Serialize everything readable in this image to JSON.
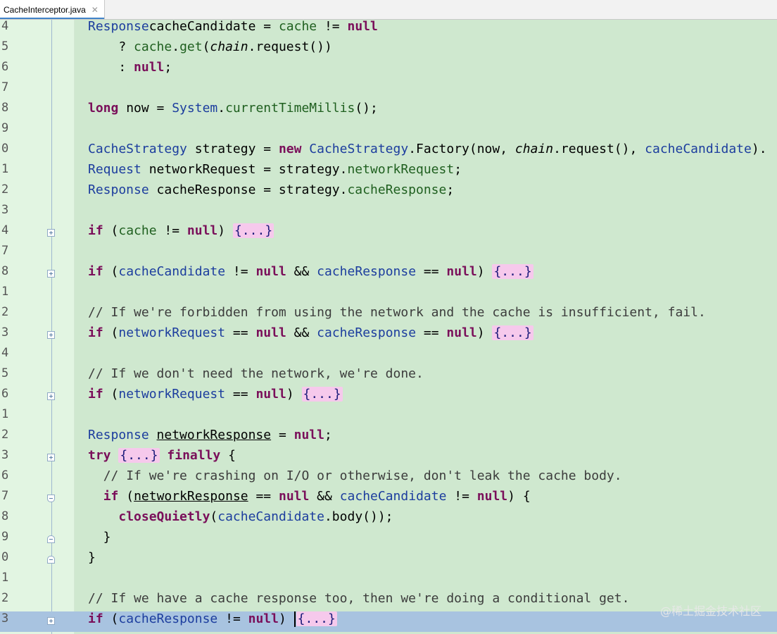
{
  "tab": {
    "title": "CacheInterceptor.java",
    "close": "✕"
  },
  "lines": [
    {
      "num": "4",
      "fold": "",
      "code": [
        [
          "ty",
          "Response"
        ],
        [
          "",
          "cacheCandidate = "
        ],
        [
          "mt",
          "cache"
        ],
        [
          "",
          " != "
        ],
        [
          "kw",
          "null"
        ]
      ]
    },
    {
      "num": "5",
      "fold": "",
      "code": [
        [
          "",
          "    ? "
        ],
        [
          "mt",
          "cache"
        ],
        [
          "",
          "."
        ],
        [
          "mt",
          "get"
        ],
        [
          "",
          "("
        ],
        [
          "it",
          "chain"
        ],
        [
          "",
          ".request())"
        ]
      ]
    },
    {
      "num": "6",
      "fold": "",
      "code": [
        [
          "",
          "    : "
        ],
        [
          "kw",
          "null"
        ],
        [
          "",
          ";"
        ]
      ]
    },
    {
      "num": "7",
      "fold": "",
      "code": []
    },
    {
      "num": "8",
      "fold": "",
      "code": [
        [
          "kw",
          "long"
        ],
        [
          "",
          " now = "
        ],
        [
          "ty",
          "System"
        ],
        [
          "",
          "."
        ],
        [
          "mt",
          "currentTimeMillis"
        ],
        [
          "",
          "();"
        ]
      ]
    },
    {
      "num": "9",
      "fold": "",
      "code": []
    },
    {
      "num": "0",
      "fold": "",
      "code": [
        [
          "ty",
          "CacheStrategy"
        ],
        [
          "",
          " strategy = "
        ],
        [
          "kw",
          "new"
        ],
        [
          "",
          " "
        ],
        [
          "ty",
          "CacheStrategy"
        ],
        [
          "",
          ".Factory(now, "
        ],
        [
          "it",
          "chain"
        ],
        [
          "",
          ".request(), "
        ],
        [
          "id",
          "cacheCandidate"
        ],
        [
          "",
          ")."
        ]
      ]
    },
    {
      "num": "1",
      "fold": "",
      "code": [
        [
          "ty",
          "Request"
        ],
        [
          "",
          " networkRequest = strategy."
        ],
        [
          "mt",
          "networkRequest"
        ],
        [
          "",
          ";"
        ]
      ]
    },
    {
      "num": "2",
      "fold": "",
      "code": [
        [
          "ty",
          "Response"
        ],
        [
          "",
          " cacheResponse = strategy."
        ],
        [
          "mt",
          "cacheResponse"
        ],
        [
          "",
          ";"
        ]
      ]
    },
    {
      "num": "3",
      "fold": "",
      "code": []
    },
    {
      "num": "4",
      "fold": "plus",
      "code": [
        [
          "kw",
          "if"
        ],
        [
          "",
          " ("
        ],
        [
          "mt",
          "cache"
        ],
        [
          "",
          " != "
        ],
        [
          "kw",
          "null"
        ],
        [
          "",
          ") "
        ],
        [
          "folded",
          "{...}"
        ]
      ]
    },
    {
      "num": "7",
      "fold": "",
      "code": []
    },
    {
      "num": "8",
      "fold": "plus",
      "code": [
        [
          "kw",
          "if"
        ],
        [
          "",
          " ("
        ],
        [
          "id",
          "cacheCandidate"
        ],
        [
          "",
          " != "
        ],
        [
          "kw",
          "null"
        ],
        [
          "",
          " && "
        ],
        [
          "id",
          "cacheResponse"
        ],
        [
          "",
          " == "
        ],
        [
          "kw",
          "null"
        ],
        [
          "",
          ") "
        ],
        [
          "folded",
          "{...}"
        ]
      ]
    },
    {
      "num": "1",
      "fold": "",
      "code": []
    },
    {
      "num": "2",
      "fold": "",
      "code": [
        [
          "cm",
          "// If we're forbidden from using the network and the cache is insufficient, fail."
        ]
      ]
    },
    {
      "num": "3",
      "fold": "plus",
      "code": [
        [
          "kw",
          "if"
        ],
        [
          "",
          " ("
        ],
        [
          "id",
          "networkRequest"
        ],
        [
          "",
          " == "
        ],
        [
          "kw",
          "null"
        ],
        [
          "",
          " && "
        ],
        [
          "id",
          "cacheResponse"
        ],
        [
          "",
          " == "
        ],
        [
          "kw",
          "null"
        ],
        [
          "",
          ") "
        ],
        [
          "folded",
          "{...}"
        ]
      ]
    },
    {
      "num": "4",
      "fold": "",
      "code": []
    },
    {
      "num": "5",
      "fold": "",
      "code": [
        [
          "cm",
          "// If we don't need the network, we're done."
        ]
      ]
    },
    {
      "num": "6",
      "fold": "plus",
      "code": [
        [
          "kw",
          "if"
        ],
        [
          "",
          " ("
        ],
        [
          "id",
          "networkRequest"
        ],
        [
          "",
          " == "
        ],
        [
          "kw",
          "null"
        ],
        [
          "",
          ") "
        ],
        [
          "folded",
          "{...}"
        ]
      ]
    },
    {
      "num": "1",
      "fold": "",
      "code": []
    },
    {
      "num": "2",
      "fold": "",
      "code": [
        [
          "ty",
          "Response"
        ],
        [
          "",
          " "
        ],
        [
          "ul",
          "networkResponse"
        ],
        [
          "",
          " = "
        ],
        [
          "kw",
          "null"
        ],
        [
          "",
          ";"
        ]
      ]
    },
    {
      "num": "3",
      "fold": "plus",
      "code": [
        [
          "kw",
          "try"
        ],
        [
          "",
          " "
        ],
        [
          "folded",
          "{...}"
        ],
        [
          "",
          " "
        ],
        [
          "kw",
          "finally"
        ],
        [
          "",
          " {"
        ]
      ]
    },
    {
      "num": "6",
      "fold": "",
      "code": [
        [
          "",
          "  "
        ],
        [
          "cm",
          "// If we're crashing on I/O or otherwise, don't leak the cache body."
        ]
      ]
    },
    {
      "num": "7",
      "fold": "shield-top",
      "code": [
        [
          "",
          "  "
        ],
        [
          "kw",
          "if"
        ],
        [
          "",
          " ("
        ],
        [
          "ul",
          "networkResponse"
        ],
        [
          "",
          " == "
        ],
        [
          "kw",
          "null"
        ],
        [
          "",
          " && "
        ],
        [
          "id",
          "cacheCandidate"
        ],
        [
          "",
          " != "
        ],
        [
          "kw",
          "null"
        ],
        [
          "",
          ") {"
        ]
      ]
    },
    {
      "num": "8",
      "fold": "",
      "code": [
        [
          "",
          "    "
        ],
        [
          "fd",
          "closeQuietly"
        ],
        [
          "",
          "("
        ],
        [
          "id",
          "cacheCandidate"
        ],
        [
          "",
          ".body());"
        ]
      ]
    },
    {
      "num": "9",
      "fold": "shield-bot",
      "code": [
        [
          "",
          "  }"
        ]
      ]
    },
    {
      "num": "0",
      "fold": "shield-bot",
      "code": [
        [
          "",
          "}"
        ]
      ]
    },
    {
      "num": "1",
      "fold": "",
      "code": []
    },
    {
      "num": "2",
      "fold": "",
      "code": [
        [
          "cm",
          "// If we have a cache response too, then we're doing a conditional get."
        ]
      ]
    },
    {
      "num": "3",
      "fold": "plus",
      "current": true,
      "code": [
        [
          "kw",
          "if"
        ],
        [
          "",
          " ("
        ],
        [
          "id",
          "cacheResponse"
        ],
        [
          "",
          " != "
        ],
        [
          "kw",
          "null"
        ],
        [
          "",
          ") "
        ],
        [
          "caret",
          ""
        ],
        [
          "folded",
          "{...}"
        ]
      ]
    }
  ],
  "watermark": "@稀土掘金技术社区"
}
